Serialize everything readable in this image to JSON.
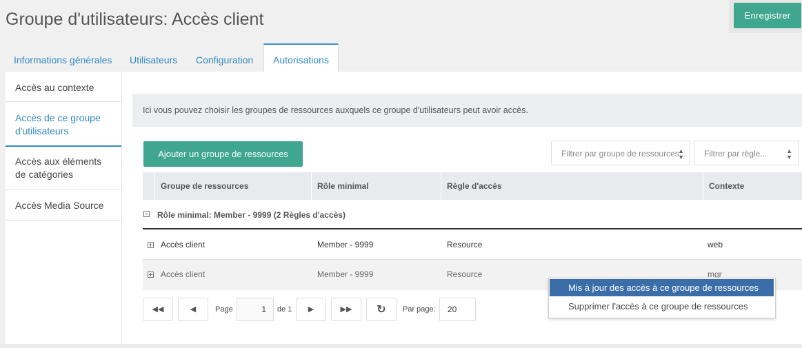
{
  "page": {
    "title": "Groupe d'utilisateurs: Accès client",
    "save_label": "Enregistrer"
  },
  "tabs": [
    {
      "label": "Informations générales",
      "active": false
    },
    {
      "label": "Utilisateurs",
      "active": false
    },
    {
      "label": "Configuration",
      "active": false
    },
    {
      "label": "Autorisations",
      "active": true
    }
  ],
  "sidebar": {
    "items": [
      {
        "label": "Accès au contexte",
        "active": false
      },
      {
        "label": "Accès de ce groupe d'utilisateurs",
        "active": true
      },
      {
        "label": "Accès aux éléments de catégories",
        "active": false
      },
      {
        "label": "Accès Media Source",
        "active": false
      }
    ]
  },
  "main": {
    "info": "Ici vous pouvez choisir les groupes de ressources auxquels ce groupe d'utilisateurs peut avoir accès.",
    "add_label": "Ajouter un groupe de ressources",
    "filter_group_placeholder": "Filtrer par groupe de ressources...",
    "filter_rule_placeholder": "Filtrer par règle..."
  },
  "grid": {
    "columns": [
      "Groupe de ressources",
      "Rôle minimal",
      "Règle d'accès",
      "Contexte"
    ],
    "group_header": "Rôle minimal: Member - 9999 (2 Règles d'accès)",
    "rows": [
      {
        "group": "Accès client",
        "role": "Member - 9999",
        "rule": "Resource",
        "context": "web"
      },
      {
        "group": "Accès client",
        "role": "Member - 9999",
        "rule": "Resource",
        "context": "mgr"
      }
    ]
  },
  "pager": {
    "page_label": "Page",
    "page_value": "1",
    "of_label": "de 1",
    "per_page_label": "Par page:",
    "per_page_value": "20"
  },
  "context_menu": {
    "items": [
      "Mis à jour des accès à ce groupe de ressources",
      "Supprimer l'accès à ce groupe de ressources"
    ]
  },
  "colors": {
    "accent": "#3fa68f",
    "link": "#3489c3",
    "menu_highlight": "#3b6ea8"
  }
}
